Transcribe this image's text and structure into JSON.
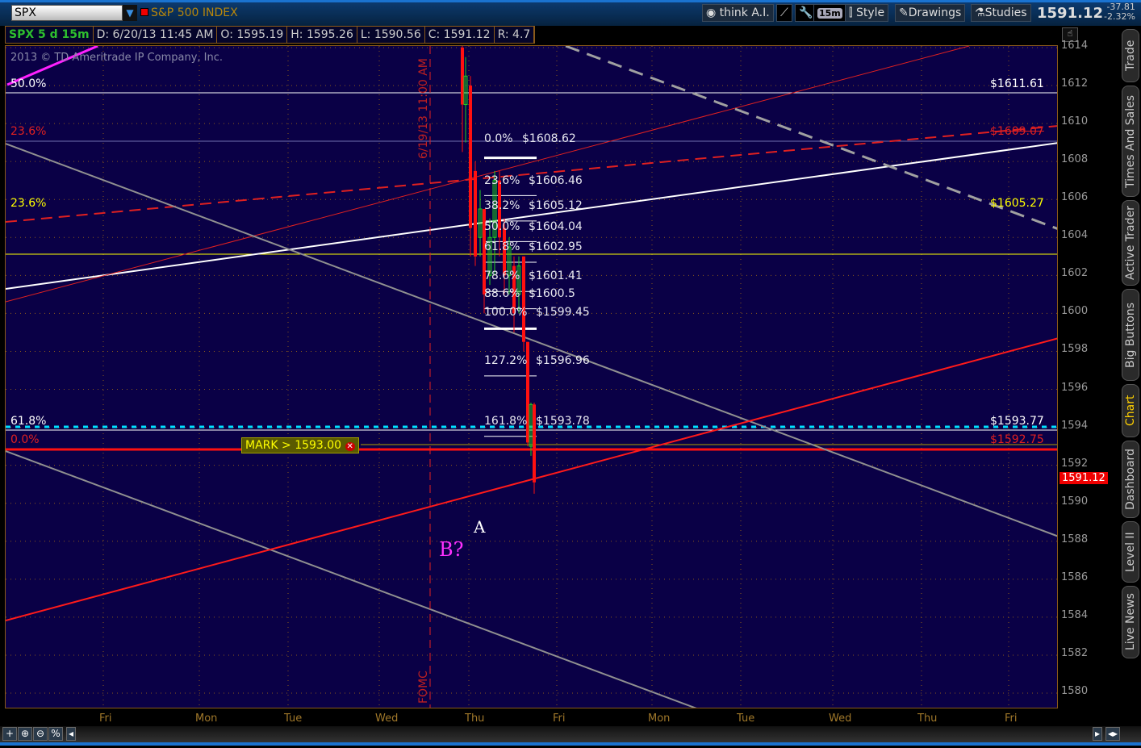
{
  "toolbar": {
    "symbol": "SPX",
    "symbol_name": "S&P 500 INDEX",
    "think_ai": "think A.I.",
    "timeframe": "15m",
    "style": "Style",
    "drawings": "Drawings",
    "studies": "Studies",
    "last": "1591.12",
    "change": "-37.81",
    "change_pct": "-2.32%"
  },
  "header": {
    "title": "SPX 5 d 15m",
    "date": "D: 6/20/13 11:45 AM",
    "open": "O: 1595.19",
    "high": "H: 1595.26",
    "low": "L: 1590.56",
    "close": "C: 1591.12",
    "range": "R: 4.7"
  },
  "copyright": "2013 © TD Ameritrade IP Company, Inc.",
  "right_tabs": [
    "Trade",
    "Times And Sales",
    "Active Trader",
    "Big Buttons",
    "Chart",
    "Dashboard",
    "Level II",
    "Live News"
  ],
  "active_tab": "Chart",
  "chart_data": {
    "type": "candlestick",
    "y_ticks": [
      "1614",
      "1612",
      "1610",
      "1608",
      "1606",
      "1604",
      "1602",
      "1600",
      "1598",
      "1596",
      "1594",
      "1592",
      "1590",
      "1588",
      "1586",
      "1584",
      "1582",
      "1580"
    ],
    "ylim": [
      1579.2,
      1614.1
    ],
    "x_ticks": [
      "Fri",
      "Mon",
      "Tue",
      "Wed",
      "Thu",
      "Fri",
      "Mon",
      "Tue",
      "Wed",
      "Thu",
      "Fri"
    ],
    "current_price_label": "1591.12",
    "event_labels": {
      "fomc": "FOMC",
      "time": "6/19/13 11:00 AM"
    },
    "level_lines": [
      {
        "left": "50.0%",
        "right": "$1611.61",
        "price": 1611.61,
        "color": "#ffffff"
      },
      {
        "left": "23.6%",
        "right": "$1609.07",
        "price": 1609.07,
        "color": "#e02020"
      },
      {
        "left": "23.6%",
        "right": "$1605.27",
        "price": 1605.27,
        "color": "#ffff00"
      },
      {
        "left": "61.8%",
        "right": "$1593.77",
        "price": 1593.77,
        "color": "#ffffff"
      },
      {
        "left": "0.0%",
        "right": "$1592.75",
        "price": 1592.75,
        "color": "#e02020"
      }
    ],
    "fib_levels": [
      {
        "pct": "0.0%",
        "price": "$1608.62",
        "value": 1608.62
      },
      {
        "pct": "23.6%",
        "price": "$1606.46",
        "value": 1606.46
      },
      {
        "pct": "38.2%",
        "price": "$1605.12",
        "value": 1605.12
      },
      {
        "pct": "50.0%",
        "price": "$1604.04",
        "value": 1604.04
      },
      {
        "pct": "61.8%",
        "price": "$1602.95",
        "value": 1602.95
      },
      {
        "pct": "78.6%",
        "price": "$1601.41",
        "value": 1601.41
      },
      {
        "pct": "88.6%",
        "price": "$1600.5",
        "value": 1600.5
      },
      {
        "pct": "100.0%",
        "price": "$1599.45",
        "value": 1599.45
      },
      {
        "pct": "127.2%",
        "price": "$1596.96",
        "value": 1596.96
      },
      {
        "pct": "161.8%",
        "price": "$1593.78",
        "value": 1593.78
      }
    ],
    "alert": {
      "label": "MARK > 1593.00",
      "value": 1593.0
    },
    "annotations": {
      "a": "A",
      "b": "B?"
    }
  },
  "bottom": {
    "percent": "%"
  }
}
